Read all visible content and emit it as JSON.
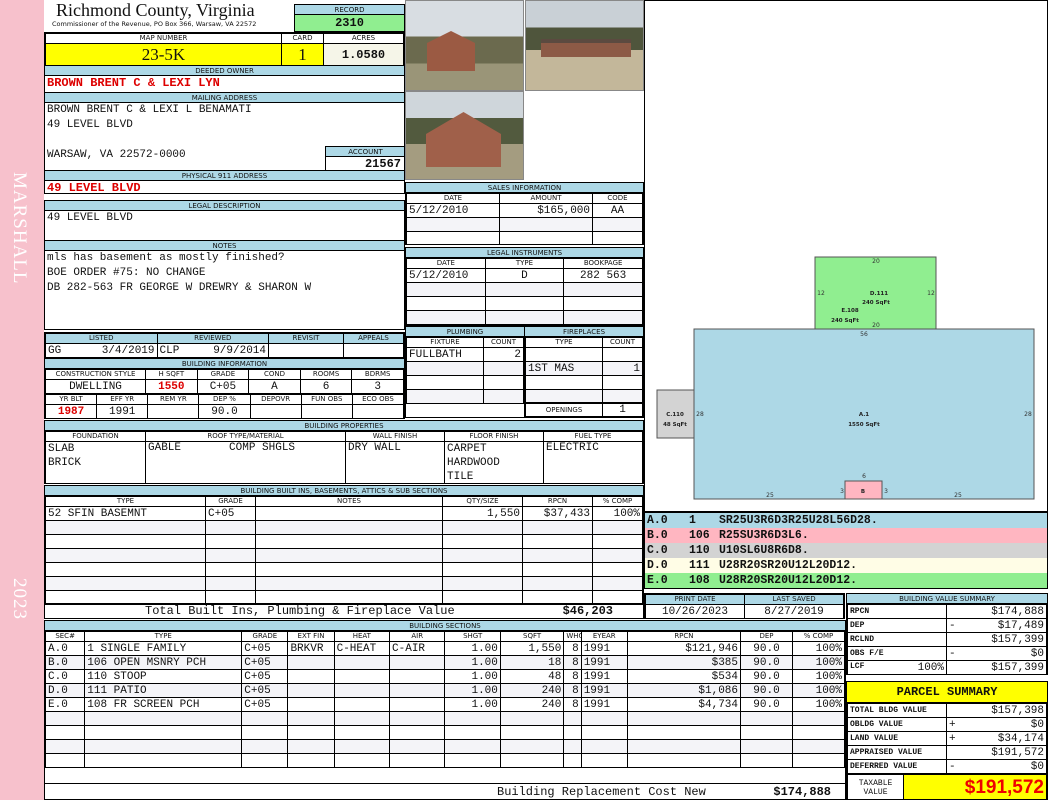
{
  "side": {
    "top": "MARSHALL",
    "bottom": "2023"
  },
  "header": {
    "title": "Richmond County, Virginia",
    "subtitle": "Commissioner of the Revenue, PO Box 366, Warsaw, VA 22572",
    "record_label": "RECORD",
    "record": "2310"
  },
  "parcel": {
    "map_label": "MAP NUMBER",
    "map": "23-5K",
    "card_label": "CARD",
    "card": "1",
    "acres_label": "ACRES",
    "acres": "1.0580"
  },
  "owner": {
    "label": "DEEDED OWNER",
    "name": "BROWN BRENT C & LEXI LYN"
  },
  "mailing": {
    "label": "MAILING ADDRESS",
    "line1": "BROWN BRENT C & LEXI L BENAMATI",
    "line2": "49 LEVEL BLVD",
    "line3": "WARSAW, VA 22572-0000",
    "account_label": "ACCOUNT",
    "account": "21567"
  },
  "physical": {
    "label": "PHYSICAL 911 ADDRESS",
    "value": "49 LEVEL BLVD"
  },
  "legal": {
    "label": "LEGAL DESCRIPTION",
    "value": "49 LEVEL BLVD"
  },
  "notes": {
    "label": "NOTES",
    "lines": [
      "mls has basement as mostly finished?",
      "BOE ORDER #75: NO CHANGE",
      "DB 282-563 FR GEORGE W DREWRY & SHARON W"
    ]
  },
  "listed": {
    "headers": [
      "LISTED",
      "REVIEWED",
      "REVISIT",
      "APPEALS"
    ],
    "listed_by": "GG",
    "listed_date": "3/4/2019",
    "reviewed_by": "CLP",
    "reviewed_date": "9/9/2014"
  },
  "building_info": {
    "label": "BUILDING INFORMATION",
    "headers1": [
      "CONSTRUCTION STYLE",
      "H SQFT",
      "GRADE",
      "COND",
      "ROOMS",
      "BDRMS"
    ],
    "row1": [
      "DWELLING",
      "1550",
      "C+05",
      "A",
      "6",
      "3"
    ],
    "headers2": [
      "YR BLT",
      "EFF YR",
      "REM YR",
      "DEP %",
      "DEPOVR",
      "FUN OBS",
      "ECO OBS"
    ],
    "row2": [
      "1987",
      "1991",
      "",
      "90.0",
      "",
      "",
      ""
    ]
  },
  "sales": {
    "label": "SALES INFORMATION",
    "headers": [
      "DATE",
      "AMOUNT",
      "CODE"
    ],
    "rows": [
      [
        "5/12/2010",
        "$165,000",
        "AA"
      ]
    ]
  },
  "instruments": {
    "label": "LEGAL INSTRUMENTS",
    "headers": [
      "DATE",
      "TYPE",
      "BOOKPAGE"
    ],
    "rows": [
      [
        "5/12/2010",
        "D",
        "282 563"
      ]
    ]
  },
  "plumbing": {
    "label": "PLUMBING",
    "headers": [
      "FIXTURE",
      "COUNT"
    ],
    "rows": [
      [
        "FULLBATH",
        "2"
      ]
    ]
  },
  "fireplaces": {
    "label": "FIREPLACES",
    "headers": [
      "TYPE",
      "COUNT"
    ],
    "rows": [
      [
        "1ST MAS",
        "1"
      ]
    ],
    "openings_label": "OPENINGS",
    "openings": "1"
  },
  "properties": {
    "label": "BUILDING PROPERTIES",
    "headers": [
      "FOUNDATION",
      "ROOF TYPE/MATERIAL",
      "WALL FINISH",
      "FLOOR FINISH",
      "FUEL TYPE"
    ],
    "foundation": [
      "SLAB",
      "BRICK"
    ],
    "roof_type": "GABLE",
    "roof_material": "COMP SHGLS",
    "wall": [
      "DRY WALL"
    ],
    "floor": [
      "CARPET",
      "HARDWOOD",
      "TILE"
    ],
    "fuel": [
      "ELECTRIC"
    ]
  },
  "builtins": {
    "label": "BUILDING BUILT INS, BASEMENTS, ATTICS & SUB SECTIONS",
    "headers": [
      "TYPE",
      "GRADE",
      "NOTES",
      "QTY/SIZE",
      "RPCN",
      "% COMP"
    ],
    "rows": [
      [
        "52 SFIN BASEMNT",
        "C+05",
        "",
        "1,550",
        "$37,433",
        "100%"
      ]
    ],
    "total_label": "Total Built Ins, Plumbing & Fireplace Value",
    "total": "$46,203"
  },
  "sketch": {
    "labels": {
      "A": "A.1",
      "A_area": "1550 SqFt",
      "B": "B",
      "C": "C.110",
      "C_area": "48 SqFt",
      "D": "D.111",
      "D_area": "240 SqFt",
      "E": "E.108",
      "E_area": "240 SqFt"
    },
    "dims": {
      "a_top": "56",
      "a_side": "28",
      "a_bottom": "25",
      "b_top": "6",
      "b_side": "3",
      "de_top": "20",
      "de_side": "12"
    }
  },
  "legend": [
    {
      "sec": "A.0",
      "code": "1",
      "path": "SR25U3R6D3R25U28L56D28.",
      "color": "#add8e6"
    },
    {
      "sec": "B.0",
      "code": "106",
      "path": "R25SU3R6D3L6.",
      "color": "#ffb6c1"
    },
    {
      "sec": "C.0",
      "code": "110",
      "path": "U10SL6U8R6D8.",
      "color": "#d3d3d3"
    },
    {
      "sec": "D.0",
      "code": "111",
      "path": "U28R20SR20U12L20D12.",
      "color": "#fffde6"
    },
    {
      "sec": "E.0",
      "code": "108",
      "path": "U28R20SR20U12L20D12.",
      "color": "#90ee90"
    }
  ],
  "dates": {
    "print_label": "PRINT DATE",
    "print": "10/26/2023",
    "saved_label": "LAST SAVED",
    "saved": "8/27/2019"
  },
  "sections": {
    "label": "BUILDING SECTIONS",
    "headers": [
      "SEC#",
      "TYPE",
      "GRADE",
      "EXT FIN",
      "HEAT",
      "AIR",
      "SHGT",
      "SQFT",
      "WHGT",
      "EYEAR",
      "RPCN",
      "DEP",
      "% COMP"
    ],
    "rows": [
      [
        "A.0",
        "1 SINGLE FAMILY",
        "C+05",
        "BRKVR",
        "C-HEAT",
        "C-AIR",
        "1.00",
        "1,550",
        "8",
        "1991",
        "$121,946",
        "90.0",
        "100%"
      ],
      [
        "B.0",
        "106 OPEN MSNRY PCH",
        "C+05",
        "",
        "",
        "",
        "1.00",
        "18",
        "8",
        "1991",
        "$385",
        "90.0",
        "100%"
      ],
      [
        "C.0",
        "110 STOOP",
        "C+05",
        "",
        "",
        "",
        "1.00",
        "48",
        "8",
        "1991",
        "$534",
        "90.0",
        "100%"
      ],
      [
        "D.0",
        "111 PATIO",
        "C+05",
        "",
        "",
        "",
        "1.00",
        "240",
        "8",
        "1991",
        "$1,086",
        "90.0",
        "100%"
      ],
      [
        "E.0",
        "108 FR SCREEN PCH",
        "C+05",
        "",
        "",
        "",
        "1.00",
        "240",
        "8",
        "1991",
        "$4,734",
        "90.0",
        "100%"
      ]
    ],
    "total_label": "Building Replacement Cost New",
    "total": "$174,888"
  },
  "value_summary": {
    "label": "BUILDING VALUE SUMMARY",
    "rows": [
      {
        "label": "RPCN",
        "sign": "",
        "value": "$174,888"
      },
      {
        "label": "DEP",
        "sign": "-",
        "value": "$17,489"
      },
      {
        "label": "RCLND",
        "sign": "",
        "value": "$157,399"
      },
      {
        "label": "OBS F/E",
        "sign": "-",
        "value": "$0"
      },
      {
        "label": "LCF",
        "pct": "100%",
        "sign": "",
        "value": "$157,399"
      }
    ]
  },
  "parcel_summary": {
    "label": "PARCEL SUMMARY",
    "rows": [
      {
        "label": "TOTAL BLDG VALUE",
        "sign": "",
        "value": "$157,398"
      },
      {
        "label": "OBLDG VALUE",
        "sign": "+",
        "value": "$0"
      },
      {
        "label": "LAND VALUE",
        "sign": "+",
        "value": "$34,174"
      },
      {
        "label": "APPRAISED VALUE",
        "sign": "",
        "value": "$191,572"
      },
      {
        "label": "DEFERRED VALUE",
        "sign": "-",
        "value": "$0"
      }
    ],
    "taxable_label": "TAXABLE VALUE",
    "taxable": "$191,572"
  }
}
